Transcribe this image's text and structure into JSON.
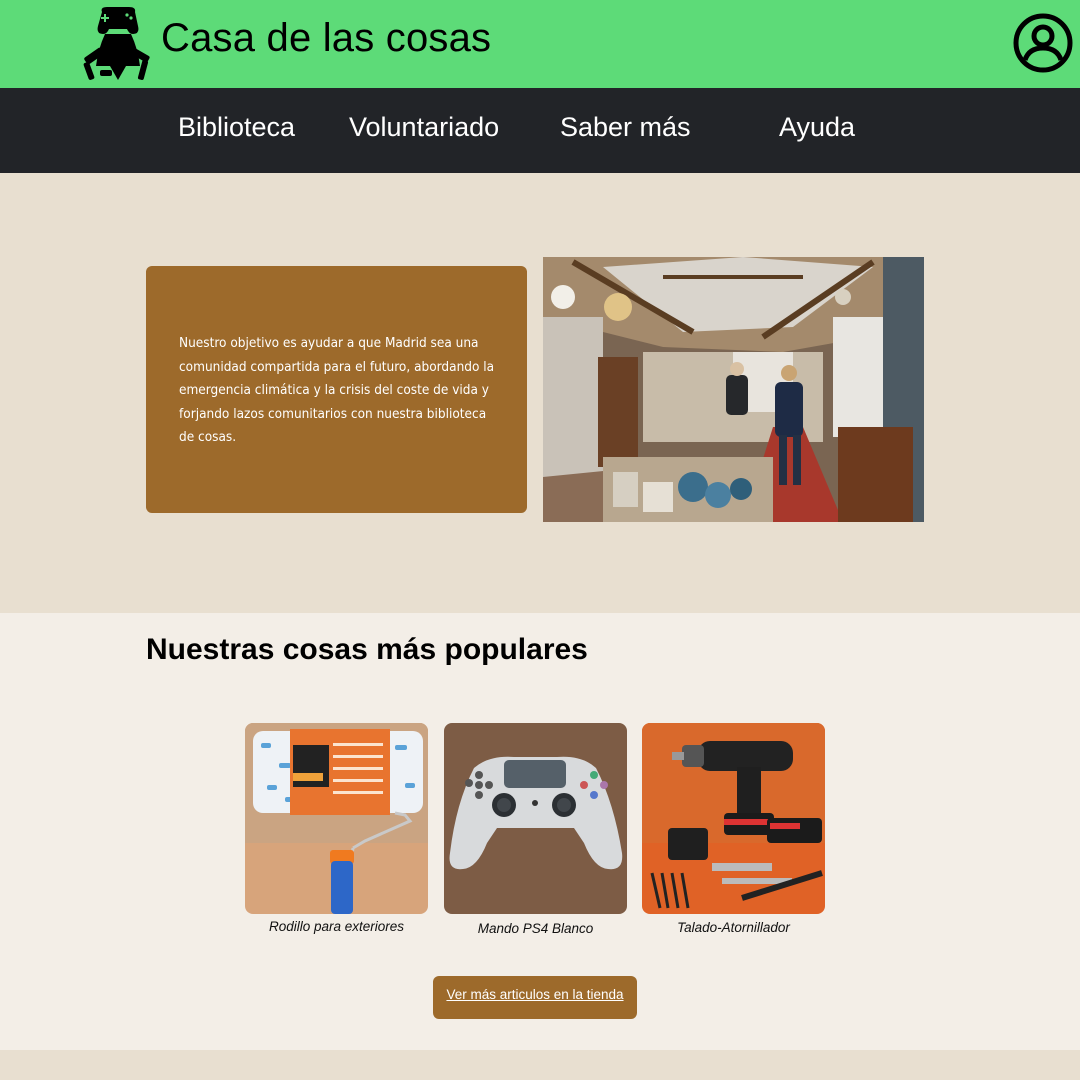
{
  "header": {
    "brand": "Casa de las cosas",
    "logo_icon": "gamepad-tools-logo",
    "account_icon": "user-account-icon",
    "background": "#5ddb78"
  },
  "nav": {
    "background": "#222428",
    "items": [
      {
        "label": "Biblioteca"
      },
      {
        "label": "Voluntariado"
      },
      {
        "label": "Saber más"
      },
      {
        "label": "Ayuda"
      }
    ]
  },
  "hero": {
    "text": "Nuestro objetivo es ayudar a que Madrid sea una comunidad compartida para el futuro, abordando la emergencia climática y la crisis del coste de vida y forjando lazos comunitarios con nuestra biblioteca de cosas.",
    "card_color": "#9d6a2b",
    "photo": "community-shop-interior-photo"
  },
  "popular": {
    "title": "Nuestras cosas más populares",
    "products": [
      {
        "caption": "Rodillo para exteriores",
        "image": "paint-roller-photo"
      },
      {
        "caption": "Mando PS4 Blanco",
        "image": "ps4-controller-photo"
      },
      {
        "caption": "Talado-Atornillador",
        "image": "cordless-drill-photo"
      }
    ],
    "shop_button": "Ver más articulos en la tienda"
  },
  "colors": {
    "accent": "#9d6a2b",
    "page_bg": "#f3eee7",
    "hero_bg": "#e8dfd0"
  }
}
